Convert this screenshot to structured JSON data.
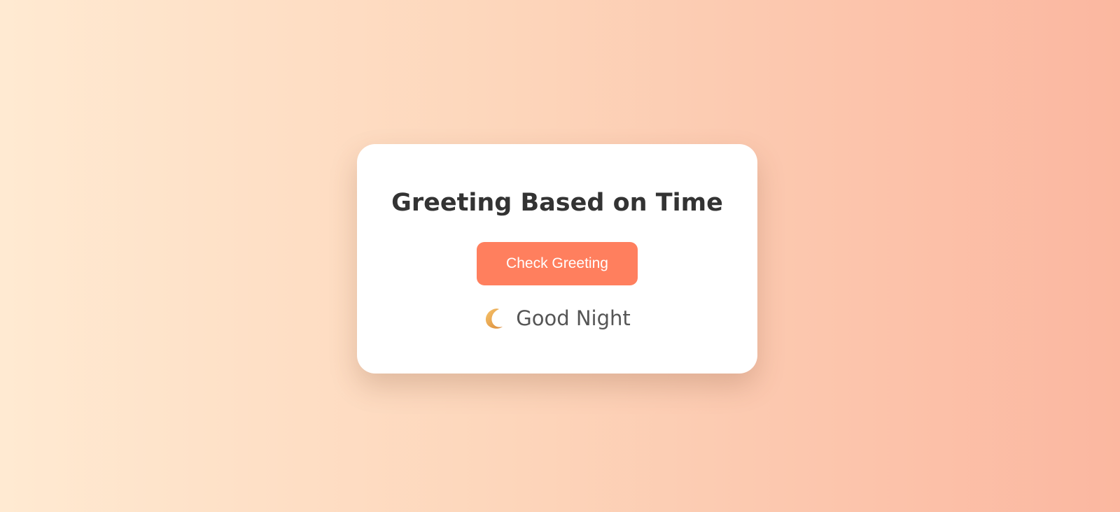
{
  "card": {
    "title": "Greeting Based on Time",
    "button_label": "Check Greeting",
    "greeting": {
      "icon": "crescent-moon-icon",
      "text": "Good Night"
    }
  },
  "colors": {
    "background_start": "#ffead2",
    "background_end": "#fbb7a0",
    "button": "#ff7f5e",
    "title": "#333333",
    "greeting_text": "#555555"
  }
}
